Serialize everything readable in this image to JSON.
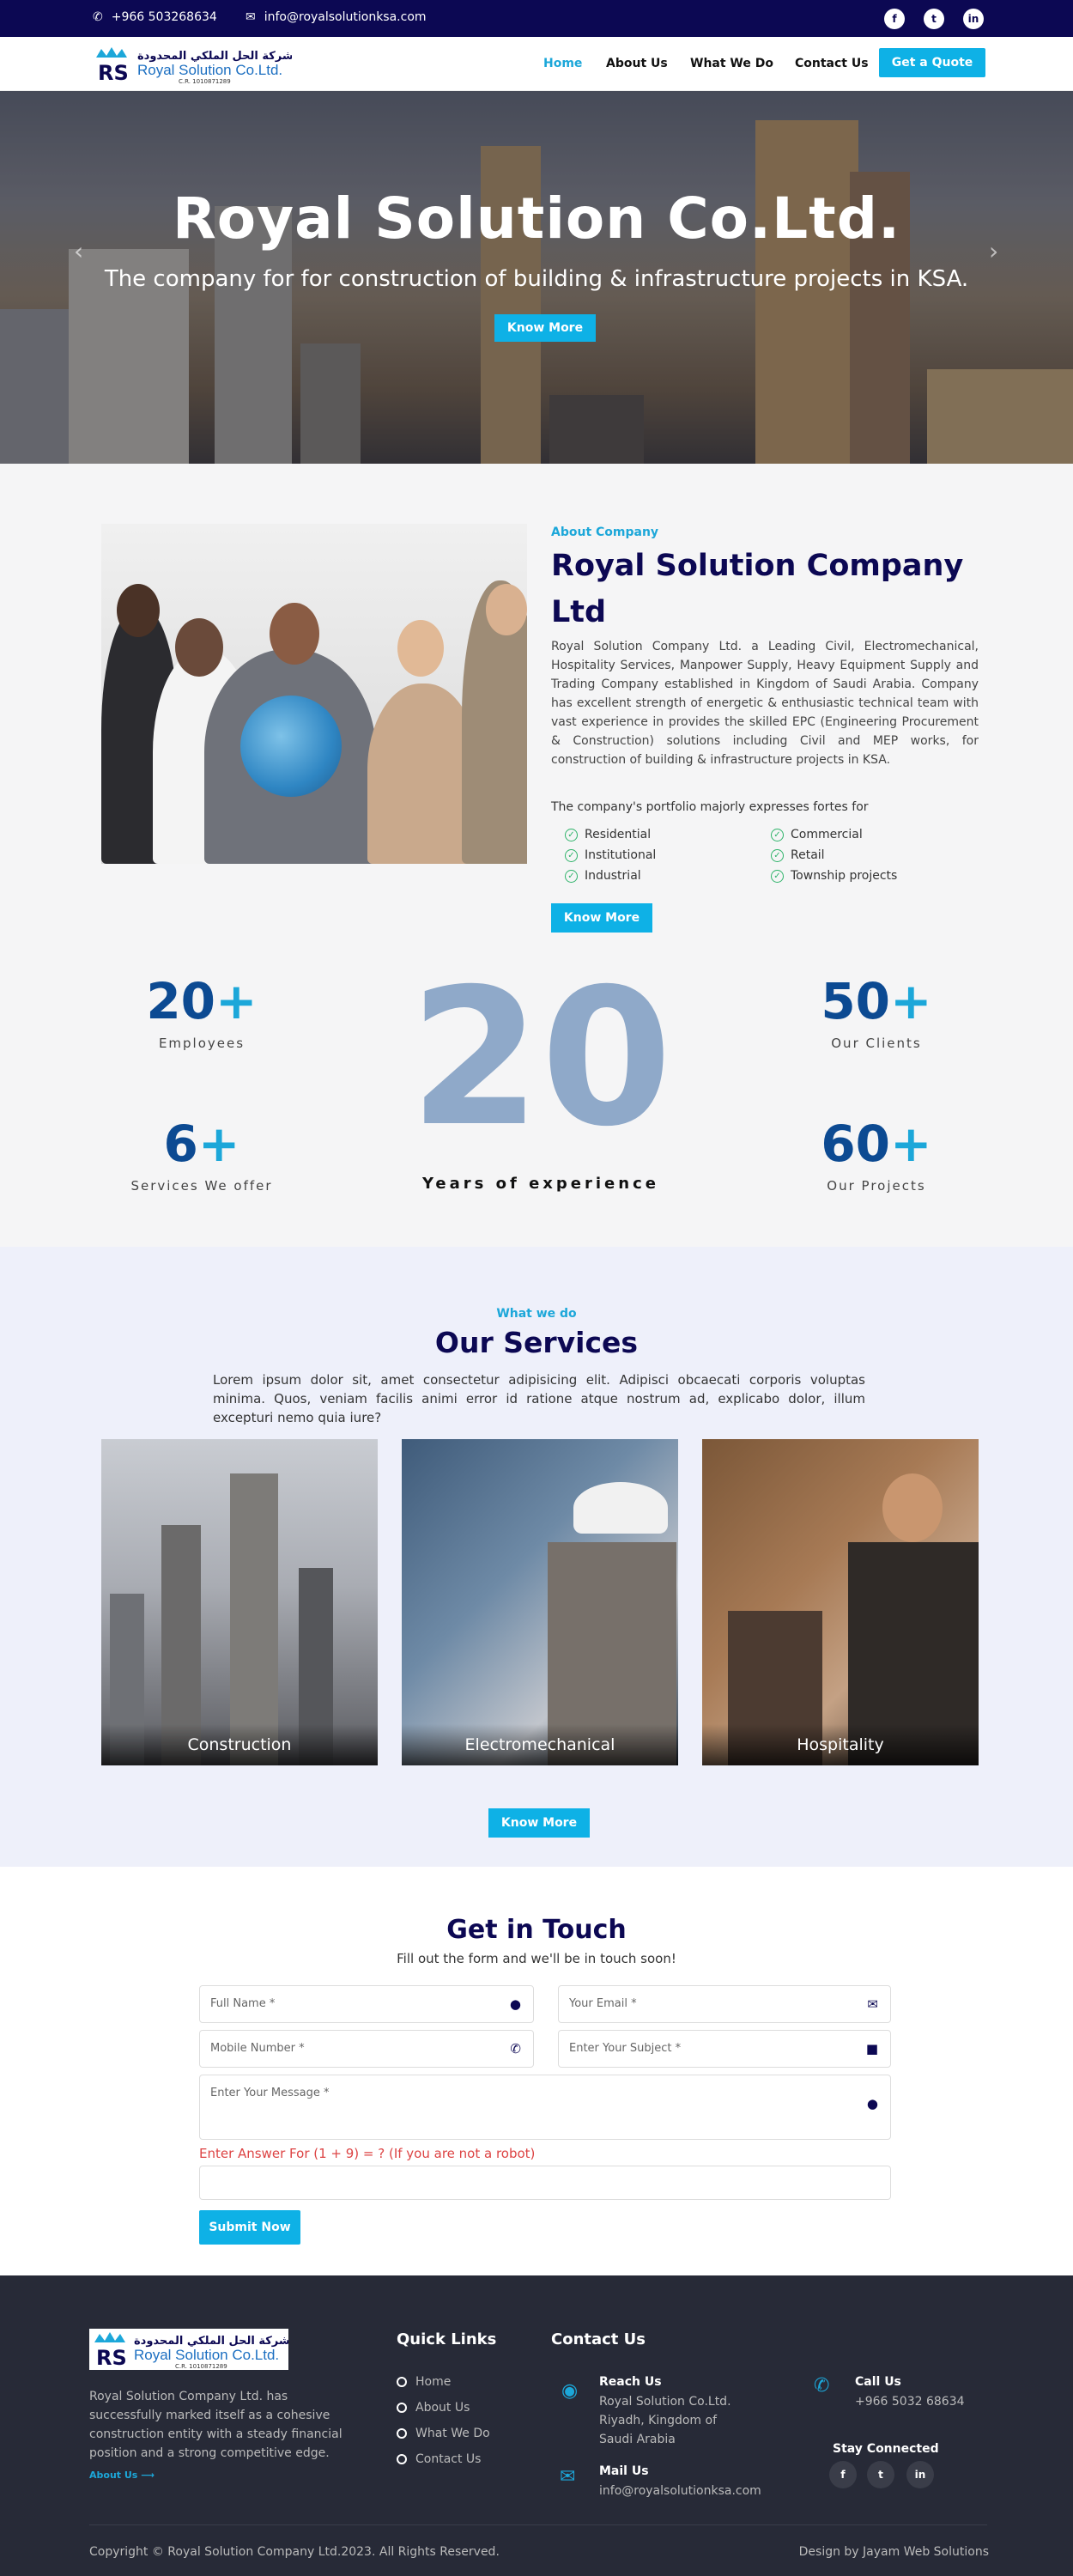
{
  "topbar": {
    "phone": "+966 503268634",
    "email": "info@royalsolutionksa.com",
    "social": [
      "f",
      "t",
      "in"
    ]
  },
  "header": {
    "logo_arabic": "شركة الحل الملكي المحدودة",
    "logo_english": "Royal Solution Co.Ltd.",
    "logo_cr": "C.R. 1010871289",
    "nav": [
      "Home",
      "About Us",
      "What We Do",
      "Contact Us"
    ],
    "cta": "Get a Quote"
  },
  "hero": {
    "title": "Royal Solution Co.Ltd.",
    "subtitle": "The company for for construction of building & infrastructure projects in KSA.",
    "button": "Know More",
    "prev": "‹",
    "next": "›"
  },
  "about": {
    "kicker": "About Company",
    "title": "Royal Solution Company Ltd",
    "text": "Royal Solution Company Ltd. a Leading Civil, Electromechanical, Hospitality Services, Manpower Supply, Heavy Equipment Supply and Trading Company established in Kingdom of Saudi Arabia. Company has excellent strength of energetic & enthusiastic technical team with vast experience in provides the skilled EPC (Engineering Procurement & Construction) solutions including Civil and MEP works, for construction of building & infrastructure projects in KSA.",
    "portfolio_intro": "The company's portfolio majorly expresses fortes for",
    "portfolio": [
      "Residential",
      "Commercial",
      "Institutional",
      "Retail",
      "Industrial",
      "Township projects"
    ],
    "button": "Know More"
  },
  "stats": {
    "employees_num": "20",
    "employees_lbl": "Employees",
    "clients_num": "50",
    "clients_lbl": "Our Clients",
    "services_num": "6",
    "services_lbl": "Services We offer",
    "projects_num": "60",
    "projects_lbl": "Our Projects",
    "plus": "+",
    "years_num": "20",
    "years_lbl": "Years of experience"
  },
  "services": {
    "kicker": "What we do",
    "title": "Our Services",
    "text": "Lorem ipsum dolor sit, amet consectetur adipisicing elit. Adipisci obcaecati corporis voluptas minima. Quos, veniam facilis animi error id ratione atque nostrum ad, explicabo dolor, illum excepturi nemo quia iure?",
    "cards": [
      "Construction",
      "Electromechanical",
      "Hospitality"
    ],
    "button": "Know More"
  },
  "contact": {
    "title": "Get in Touch",
    "subtitle": "Fill out the form and we'll be in touch soon!",
    "full_name": "Full Name *",
    "email": "Your Email *",
    "mobile": "Mobile Number *",
    "subject": "Enter Your Subject *",
    "message": "Enter Your Message *",
    "captcha": "Enter Answer For (1 + 9) = ? (If you are not a robot)",
    "submit": "Submit Now"
  },
  "footer": {
    "about": "Royal Solution Company Ltd. has successfully marked itself as a cohesive construction entity with a steady financial position and a strong competitive edge.",
    "about_link": "About Us",
    "quick_links_title": "Quick Links",
    "quick_links": [
      "Home",
      "About Us",
      "What We Do",
      "Contact Us"
    ],
    "contact_title": "Contact Us",
    "reach_title": "Reach Us",
    "reach_text": "Royal Solution Co.Ltd. Riyadh, Kingdom of Saudi Arabia",
    "mail_title": "Mail Us",
    "mail_text": "info@royalsolutionksa.com",
    "call_title": "Call Us",
    "call_text": "+966 5032 68634",
    "stay_title": "Stay Connected",
    "social": [
      "f",
      "t",
      "in"
    ],
    "copyright": "Copyright © Royal Solution Company Ltd.2023. All Rights Reserved.",
    "design": "Design by Jayam Web Solutions"
  },
  "colors": {
    "navy": "#0c0853",
    "accent": "#0eb1e6",
    "footer": "#272a37"
  }
}
